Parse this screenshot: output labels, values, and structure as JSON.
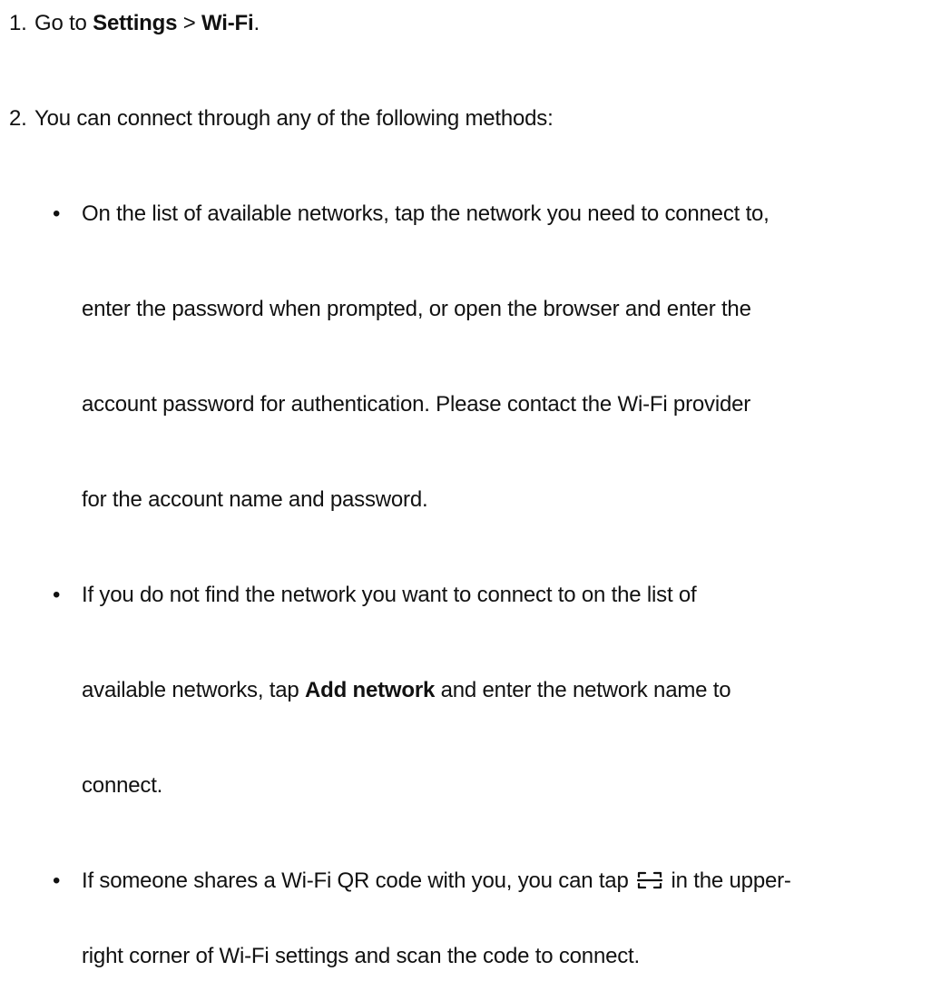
{
  "steps": [
    {
      "number": "1.",
      "prefix": "Go to ",
      "settings": "Settings",
      "separator": " > ",
      "wifi": "Wi-Fi",
      "suffix": "."
    },
    {
      "number": "2.",
      "text": "You can connect through any of the following methods:"
    }
  ],
  "bullet_char": "•",
  "methods": {
    "list": {
      "line1": "On the list of available networks, tap the network you need to connect to,",
      "line2": "enter the password when prompted, or open the browser and enter the",
      "line3": "account password for authentication. Please contact the Wi-Fi provider",
      "line4": "for the account name and password."
    },
    "add": {
      "line1": "If you do not find the network you want to connect to on the list of",
      "line2_pre": "available networks, tap ",
      "line2_bold": "Add network",
      "line2_post": " and enter the network name to",
      "line3": "connect."
    },
    "qr": {
      "line1_pre": "If someone shares a Wi-Fi QR code with you, you can tap ",
      "icon": "scan-icon",
      "line1_post": " in the upper-",
      "line2": "right corner of Wi-Fi settings and scan the code to connect."
    }
  }
}
